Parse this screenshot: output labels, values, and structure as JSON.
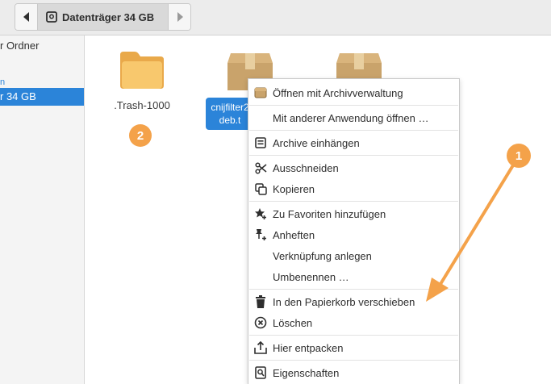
{
  "toolbar": {
    "path_label": "Datenträger 34 GB",
    "back_icon": "chevron-left-icon",
    "forward_icon": "chevron-right-icon"
  },
  "sidebar": {
    "items": [
      {
        "label": "r Ordner"
      },
      {
        "label": "n"
      },
      {
        "label": "r 34 GB"
      }
    ]
  },
  "files": {
    "trash_folder": {
      "label": ".Trash-1000"
    },
    "selected_package": {
      "label_line1": "cnijfilter2",
      "label_line2": "deb.t"
    }
  },
  "badges": {
    "badge2": "2",
    "badge1": "1"
  },
  "context_menu": {
    "items": [
      {
        "label": "Öffnen mit Archivverwaltung",
        "icon": "archive-icon"
      },
      {
        "label": "Mit anderer Anwendung öffnen …",
        "icon": ""
      },
      {
        "label": "Archive einhängen",
        "icon": "mount-icon"
      },
      {
        "label": "Ausschneiden",
        "icon": "scissors-icon"
      },
      {
        "label": "Kopieren",
        "icon": "copy-icon"
      },
      {
        "label": "Zu Favoriten hinzufügen",
        "icon": "star-add-icon"
      },
      {
        "label": "Anheften",
        "icon": "pin-icon"
      },
      {
        "label": "Verknüpfung anlegen",
        "icon": ""
      },
      {
        "label": "Umbenennen …",
        "icon": ""
      },
      {
        "label": "In den Papierkorb verschieben",
        "icon": "trash-icon"
      },
      {
        "label": "Löschen",
        "icon": "delete-icon"
      },
      {
        "label": "Hier entpacken",
        "icon": "extract-icon"
      },
      {
        "label": "Eigenschaften",
        "icon": "properties-icon"
      }
    ]
  },
  "colors": {
    "selection_blue": "#2b84d9",
    "annotation_orange": "#f4a24a",
    "folder_yellow": "#f5c46b",
    "package_tan": "#c9a36b"
  }
}
